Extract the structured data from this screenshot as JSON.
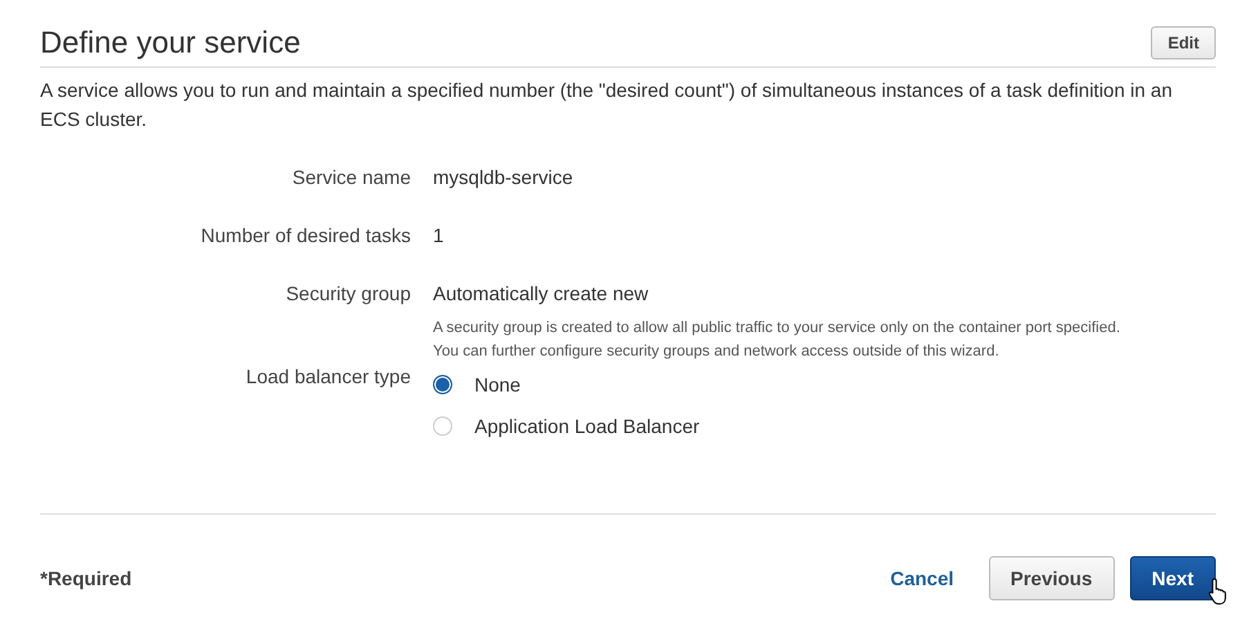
{
  "header": {
    "title": "Define your service",
    "edit_button": "Edit"
  },
  "description": "A service allows you to run and maintain a specified number (the \"desired count\") of simultaneous instances of a task definition in an ECS cluster.",
  "fields": [
    {
      "kind": "text",
      "label": "Service name",
      "value": "mysqldb-service"
    },
    {
      "kind": "text",
      "label": "Number of desired tasks",
      "value": "1"
    },
    {
      "kind": "text",
      "label": "Security group",
      "value": "Automatically create new",
      "help": [
        "A security group is created to allow all public traffic to your service only on the container port specified.",
        "You can further configure security groups and network access outside of this wizard."
      ]
    },
    {
      "kind": "radio",
      "label": "Load balancer type",
      "options": [
        {
          "label": "None",
          "selected": true
        },
        {
          "label": "Application Load Balancer",
          "selected": false
        }
      ]
    }
  ],
  "footer": {
    "required_note": "*Required",
    "cancel": "Cancel",
    "previous": "Previous",
    "next": "Next"
  }
}
